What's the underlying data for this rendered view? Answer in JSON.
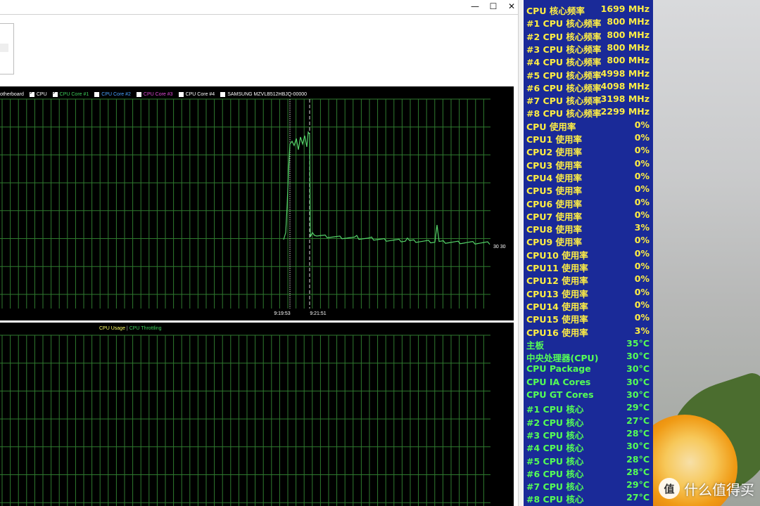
{
  "window": {
    "controls": {
      "minimize": "—",
      "maximize": "☐",
      "close": "✕"
    }
  },
  "graph_top": {
    "legend": [
      {
        "label": "otherboard",
        "color": "#ffffff",
        "checkbox": false
      },
      {
        "label": "CPU",
        "color": "#ffffff",
        "checkbox": true,
        "checked": true
      },
      {
        "label": "CPU Core #1",
        "color": "#3ecf5b",
        "checkbox": true,
        "checked": true
      },
      {
        "label": "CPU Core #2",
        "color": "#4aa3ff",
        "checkbox": true,
        "checked": false
      },
      {
        "label": "CPU Core #3",
        "color": "#e04ad8",
        "checkbox": true,
        "checked": false
      },
      {
        "label": "CPU Core #4",
        "color": "#ffffff",
        "checkbox": true,
        "checked": false
      },
      {
        "label": "SAMSUNG MZVLB512HBJQ-00000",
        "color": "#ffffff",
        "checkbox": true,
        "checked": false
      }
    ],
    "time_labels": [
      "9:19:53",
      "9:21:51"
    ],
    "end_label": "30 30"
  },
  "graph_bottom": {
    "legend_usage": "CPU Usage",
    "legend_sep": "|",
    "legend_throttle": "CPU Throttling",
    "usage_color": "#ffff66",
    "throttle_color": "#3ecf5b"
  },
  "osd": {
    "colors": {
      "freq": "#ffee44",
      "usage": "#ffee44",
      "temp": "#55ff55",
      "background": "#1a2a98"
    },
    "rows": [
      {
        "label": "CPU 核心频率",
        "value": "1699 MHz",
        "kind": "freq"
      },
      {
        "label": "#1 CPU 核心频率",
        "value": "800 MHz",
        "kind": "freq"
      },
      {
        "label": "#2 CPU 核心频率",
        "value": "800 MHz",
        "kind": "freq"
      },
      {
        "label": "#3 CPU 核心频率",
        "value": "800 MHz",
        "kind": "freq"
      },
      {
        "label": "#4 CPU 核心频率",
        "value": "800 MHz",
        "kind": "freq"
      },
      {
        "label": "#5 CPU 核心频率",
        "value": "4998 MHz",
        "kind": "freq"
      },
      {
        "label": "#6 CPU 核心频率",
        "value": "4098 MHz",
        "kind": "freq"
      },
      {
        "label": "#7 CPU 核心频率",
        "value": "3198 MHz",
        "kind": "freq"
      },
      {
        "label": "#8 CPU 核心频率",
        "value": "2299 MHz",
        "kind": "freq"
      },
      {
        "label": "CPU 使用率",
        "value": "0%",
        "kind": "usage"
      },
      {
        "label": "CPU1 使用率",
        "value": "0%",
        "kind": "usage"
      },
      {
        "label": "CPU2 使用率",
        "value": "0%",
        "kind": "usage"
      },
      {
        "label": "CPU3 使用率",
        "value": "0%",
        "kind": "usage"
      },
      {
        "label": "CPU4 使用率",
        "value": "0%",
        "kind": "usage"
      },
      {
        "label": "CPU5 使用率",
        "value": "0%",
        "kind": "usage"
      },
      {
        "label": "CPU6 使用率",
        "value": "0%",
        "kind": "usage"
      },
      {
        "label": "CPU7 使用率",
        "value": "0%",
        "kind": "usage"
      },
      {
        "label": "CPU8 使用率",
        "value": "3%",
        "kind": "usage"
      },
      {
        "label": "CPU9 使用率",
        "value": "0%",
        "kind": "usage"
      },
      {
        "label": "CPU10 使用率",
        "value": "0%",
        "kind": "usage"
      },
      {
        "label": "CPU11 使用率",
        "value": "0%",
        "kind": "usage"
      },
      {
        "label": "CPU12 使用率",
        "value": "0%",
        "kind": "usage"
      },
      {
        "label": "CPU13 使用率",
        "value": "0%",
        "kind": "usage"
      },
      {
        "label": "CPU14 使用率",
        "value": "0%",
        "kind": "usage"
      },
      {
        "label": "CPU15 使用率",
        "value": "0%",
        "kind": "usage"
      },
      {
        "label": "CPU16 使用率",
        "value": "3%",
        "kind": "usage"
      },
      {
        "label": "主板",
        "value": "35°C",
        "kind": "temp"
      },
      {
        "label": "中央处理器(CPU)",
        "value": "30°C",
        "kind": "temp"
      },
      {
        "label": "CPU Package",
        "value": "30°C",
        "kind": "temp"
      },
      {
        "label": "CPU IA Cores",
        "value": "30°C",
        "kind": "temp"
      },
      {
        "label": "CPU GT Cores",
        "value": "30°C",
        "kind": "temp"
      },
      {
        "label": " #1 CPU 核心",
        "value": "29°C",
        "kind": "temp"
      },
      {
        "label": " #2 CPU 核心",
        "value": "27°C",
        "kind": "temp"
      },
      {
        "label": " #3 CPU 核心",
        "value": "28°C",
        "kind": "temp"
      },
      {
        "label": " #4 CPU 核心",
        "value": "30°C",
        "kind": "temp"
      },
      {
        "label": " #5 CPU 核心",
        "value": "28°C",
        "kind": "temp"
      },
      {
        "label": " #6 CPU 核心",
        "value": "28°C",
        "kind": "temp"
      },
      {
        "label": " #7 CPU 核心",
        "value": "29°C",
        "kind": "temp"
      },
      {
        "label": " #8 CPU 核心",
        "value": "27°C",
        "kind": "temp"
      }
    ]
  },
  "watermark": {
    "logo": "值",
    "text": "什么值得买"
  }
}
